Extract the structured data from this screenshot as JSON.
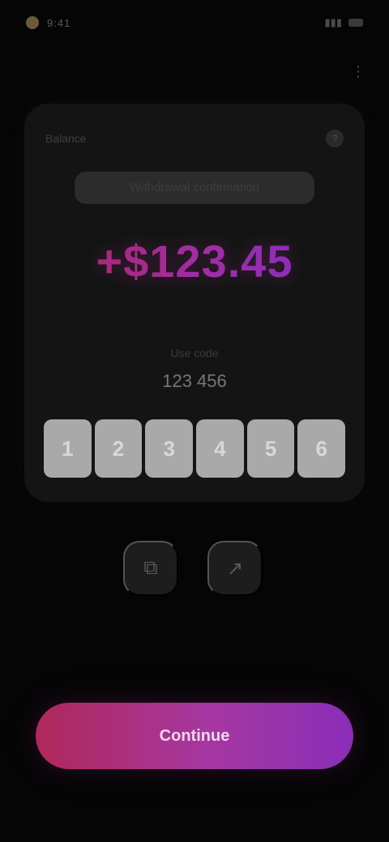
{
  "status_bar": {
    "time": "9:41",
    "signal": "▮▮▮",
    "battery": "■"
  },
  "top_menu": {
    "icon": "more-icon"
  },
  "card": {
    "label": "Balance",
    "label_icon": "help-icon",
    "title": "Withdrawal confirmation",
    "amount": "+$123.45",
    "sub_top": "Use code",
    "sub_main": "123 456",
    "code": [
      "1",
      "2",
      "3",
      "4",
      "5",
      "6"
    ]
  },
  "actions": {
    "left_icon": "copy-icon",
    "right_icon": "share-icon"
  },
  "cta": {
    "label": "Continue"
  },
  "colors": {
    "accent_start": "#b3245a",
    "accent_end": "#7d2ec4",
    "background": "#050505",
    "card": "#141414"
  }
}
